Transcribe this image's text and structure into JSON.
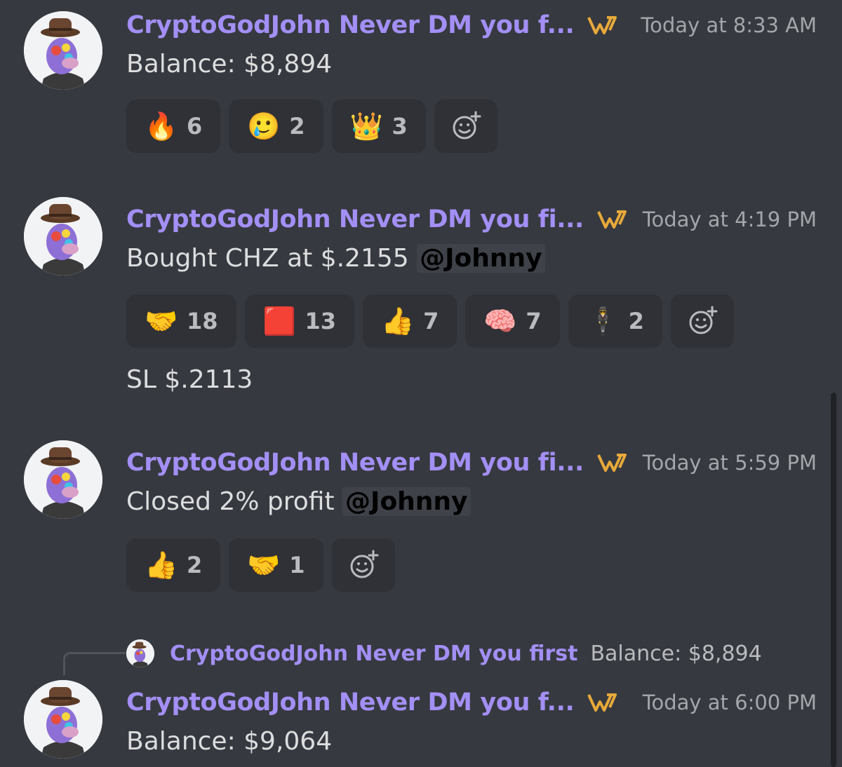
{
  "messages": [
    {
      "username": "CryptoGodJohn Never DM you f...",
      "timestamp": "Today at 8:33 AM",
      "text": "Balance: $8,894",
      "reactions": [
        {
          "emoji": "🔥",
          "count": "6"
        },
        {
          "emoji": "🥲",
          "count": "2"
        },
        {
          "emoji": "👑",
          "count": "3"
        }
      ]
    },
    {
      "username": "CryptoGodJohn Never DM you fi...",
      "timestamp": "Today at 4:19 PM",
      "text": "Bought CHZ at $.2155 ",
      "mention": "@Johnny",
      "reactions": [
        {
          "emoji": "🤝",
          "count": "18"
        },
        {
          "emoji": "🟥",
          "count": "13"
        },
        {
          "emoji": "👍",
          "count": "7"
        },
        {
          "emoji": "🧠",
          "count": "7"
        },
        {
          "emoji": "🕴",
          "count": "2"
        }
      ],
      "followup": "SL $.2113"
    },
    {
      "username": "CryptoGodJohn Never DM you fi...",
      "timestamp": "Today at 5:59 PM",
      "text": "Closed 2% profit ",
      "mention": "@Johnny",
      "reactions": [
        {
          "emoji": "👍",
          "count": "2"
        },
        {
          "emoji": "🤝",
          "count": "1"
        }
      ]
    },
    {
      "reply": {
        "username": "CryptoGodJohn Never DM you first",
        "text": "Balance: $8,894"
      },
      "username": "CryptoGodJohn Never DM you f...",
      "timestamp": "Today at 6:00 PM",
      "text": "Balance: $9,064"
    }
  ],
  "colors": {
    "background": "#36393f",
    "username": "#a38ff5",
    "reaction_bg": "#2f3136",
    "tag_icon": "#e8a93a"
  }
}
